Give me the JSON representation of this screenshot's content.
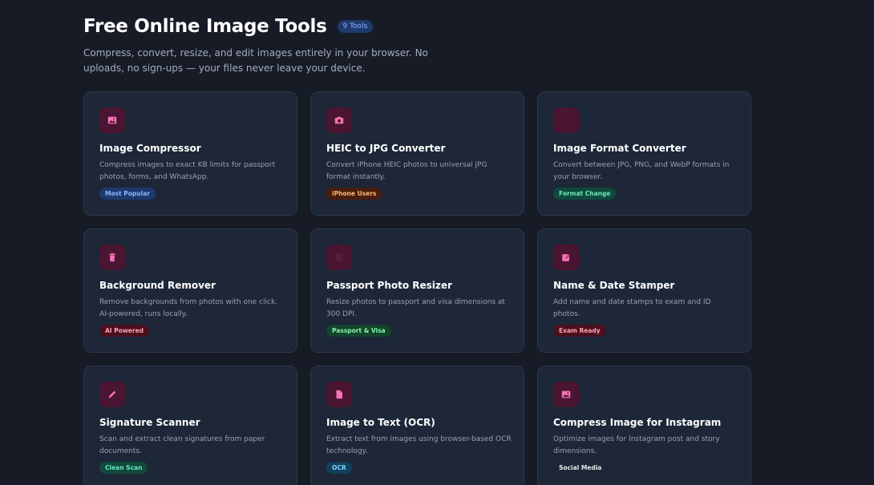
{
  "header": {
    "title": "Free Online Image Tools",
    "count_badge": "9 Tools",
    "subtitle": "Compress, convert, resize, and edit images entirely in your browser. No uploads, no sign-ups — your files never leave your device."
  },
  "tools": [
    {
      "title": "Image Compressor",
      "description": "Compress images to exact KB limits for passport photos, forms, and WhatsApp.",
      "tag": "Most Popular",
      "tag_bg": "#1e3a6e",
      "tag_color": "#8fb4ff",
      "icon": "image-icon"
    },
    {
      "title": "HEIC to JPG Converter",
      "description": "Convert iPhone HEIC photos to universal JPG format instantly.",
      "tag": "iPhone Users",
      "tag_bg": "#4a1d0e",
      "tag_color": "#fdba74",
      "icon": "camera-icon"
    },
    {
      "title": "Image Format Converter",
      "description": "Convert between JPG, PNG, and WebP formats in your browser.",
      "tag": "Format Change",
      "tag_bg": "#0f4a3c",
      "tag_color": "#6ee7b7",
      "icon": "convert-icon"
    },
    {
      "title": "Background Remover",
      "description": "Remove backgrounds from photos with one click. AI-powered, runs locally.",
      "tag": "AI Powered",
      "tag_bg": "#4a1020",
      "tag_color": "#fda4af",
      "icon": "trash-icon"
    },
    {
      "title": "Passport Photo Resizer",
      "description": "Resize photos to passport and visa dimensions at 300 DPI.",
      "tag": "Passport & Visa",
      "tag_bg": "#14452a",
      "tag_color": "#86efac",
      "icon": "passport-icon"
    },
    {
      "title": "Name & Date Stamper",
      "description": "Add name and date stamps to exam and ID photos.",
      "tag": "Exam Ready",
      "tag_bg": "#4a1020",
      "tag_color": "#fda4af",
      "icon": "edit-icon"
    },
    {
      "title": "Signature Scanner",
      "description": "Scan and extract clean signatures from paper documents.",
      "tag": "Clean Scan",
      "tag_bg": "#0f4a3c",
      "tag_color": "#6ee7b7",
      "icon": "pen-icon"
    },
    {
      "title": "Image to Text (OCR)",
      "description": "Extract text from images using browser-based OCR technology.",
      "tag": "OCR",
      "tag_bg": "#10405a",
      "tag_color": "#7dd3fc",
      "icon": "document-icon"
    },
    {
      "title": "Compress Image for Instagram",
      "description": "Optimize images for Instagram post and story dimensions.",
      "tag": "Social Media",
      "tag_bg": "#1d2738",
      "tag_color": "#e5e7eb",
      "icon": "image-icon"
    }
  ]
}
